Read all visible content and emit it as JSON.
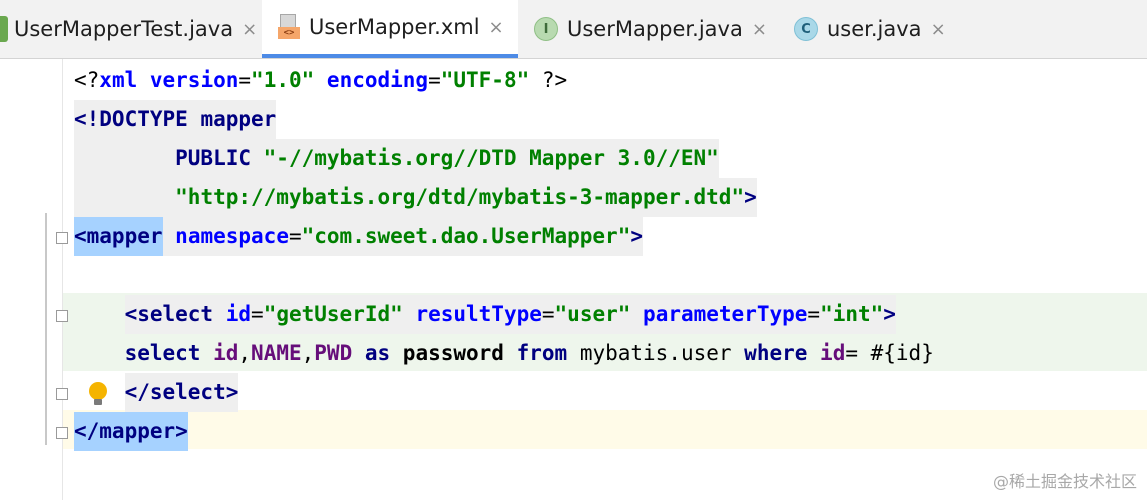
{
  "tabs": [
    {
      "label": "UserMapperTest.java",
      "icon": "java-test-class-icon",
      "active": false
    },
    {
      "label": "UserMapper.xml",
      "icon": "xml-file-icon",
      "active": true
    },
    {
      "label": "UserMapper.java",
      "icon": "java-interface-icon",
      "icon_letter": "I",
      "active": false
    },
    {
      "label": "user.java",
      "icon": "java-class-icon",
      "icon_letter": "C",
      "active": false
    }
  ],
  "close_glyph": "×",
  "code": {
    "l1": {
      "a": "<?",
      "b": "xml ",
      "c": "version",
      "d": "=",
      "e": "\"1.0\"",
      "f": " ",
      "g": "encoding",
      "h": "=",
      "i": "\"UTF-8\"",
      "j": " ?>"
    },
    "l2": {
      "a": "<!DOCTYPE ",
      "b": "mapper"
    },
    "l3": {
      "a": "        PUBLIC ",
      "b": "\"-//mybatis.org//DTD Mapper 3.0//EN\""
    },
    "l4": {
      "a": "        ",
      "b": "\"http://mybatis.org/dtd/mybatis-3-mapper.dtd\"",
      "c": ">"
    },
    "l5": {
      "a": "<mapper",
      "b": " ",
      "c": "namespace",
      "d": "=",
      "e": "\"com.sweet.dao.UserMapper\"",
      "f": ">"
    },
    "l7": {
      "a": "    ",
      "b": "<select",
      "c": " ",
      "d": "id",
      "e": "=",
      "f": "\"getUserId\"",
      "g": " ",
      "h": "resultType",
      "i": "=",
      "j": "\"user\"",
      "k": " ",
      "l": "parameterType",
      "m": "=",
      "n": "\"int\"",
      "o": ">"
    },
    "l8": {
      "a": "    ",
      "b": "select ",
      "c": "id",
      "d": ",",
      "e": "NAME",
      "f": ",",
      "g": "PWD",
      "h": " as ",
      "i": "password",
      "j": " from ",
      "k": "mybatis.user",
      "l": " where ",
      "m": "id",
      "n": "= #{id}"
    },
    "l9": {
      "a": "    ",
      "b": "</select>"
    },
    "l10": {
      "a": "</mapper>"
    }
  },
  "watermark": "@稀土掘金技术社区",
  "colors": {
    "tag": "#000080",
    "attr": "#0000ff",
    "value": "#008000",
    "column": "#660e7a",
    "selection": "#a6d2ff",
    "tab_underline": "#4d8be6"
  }
}
